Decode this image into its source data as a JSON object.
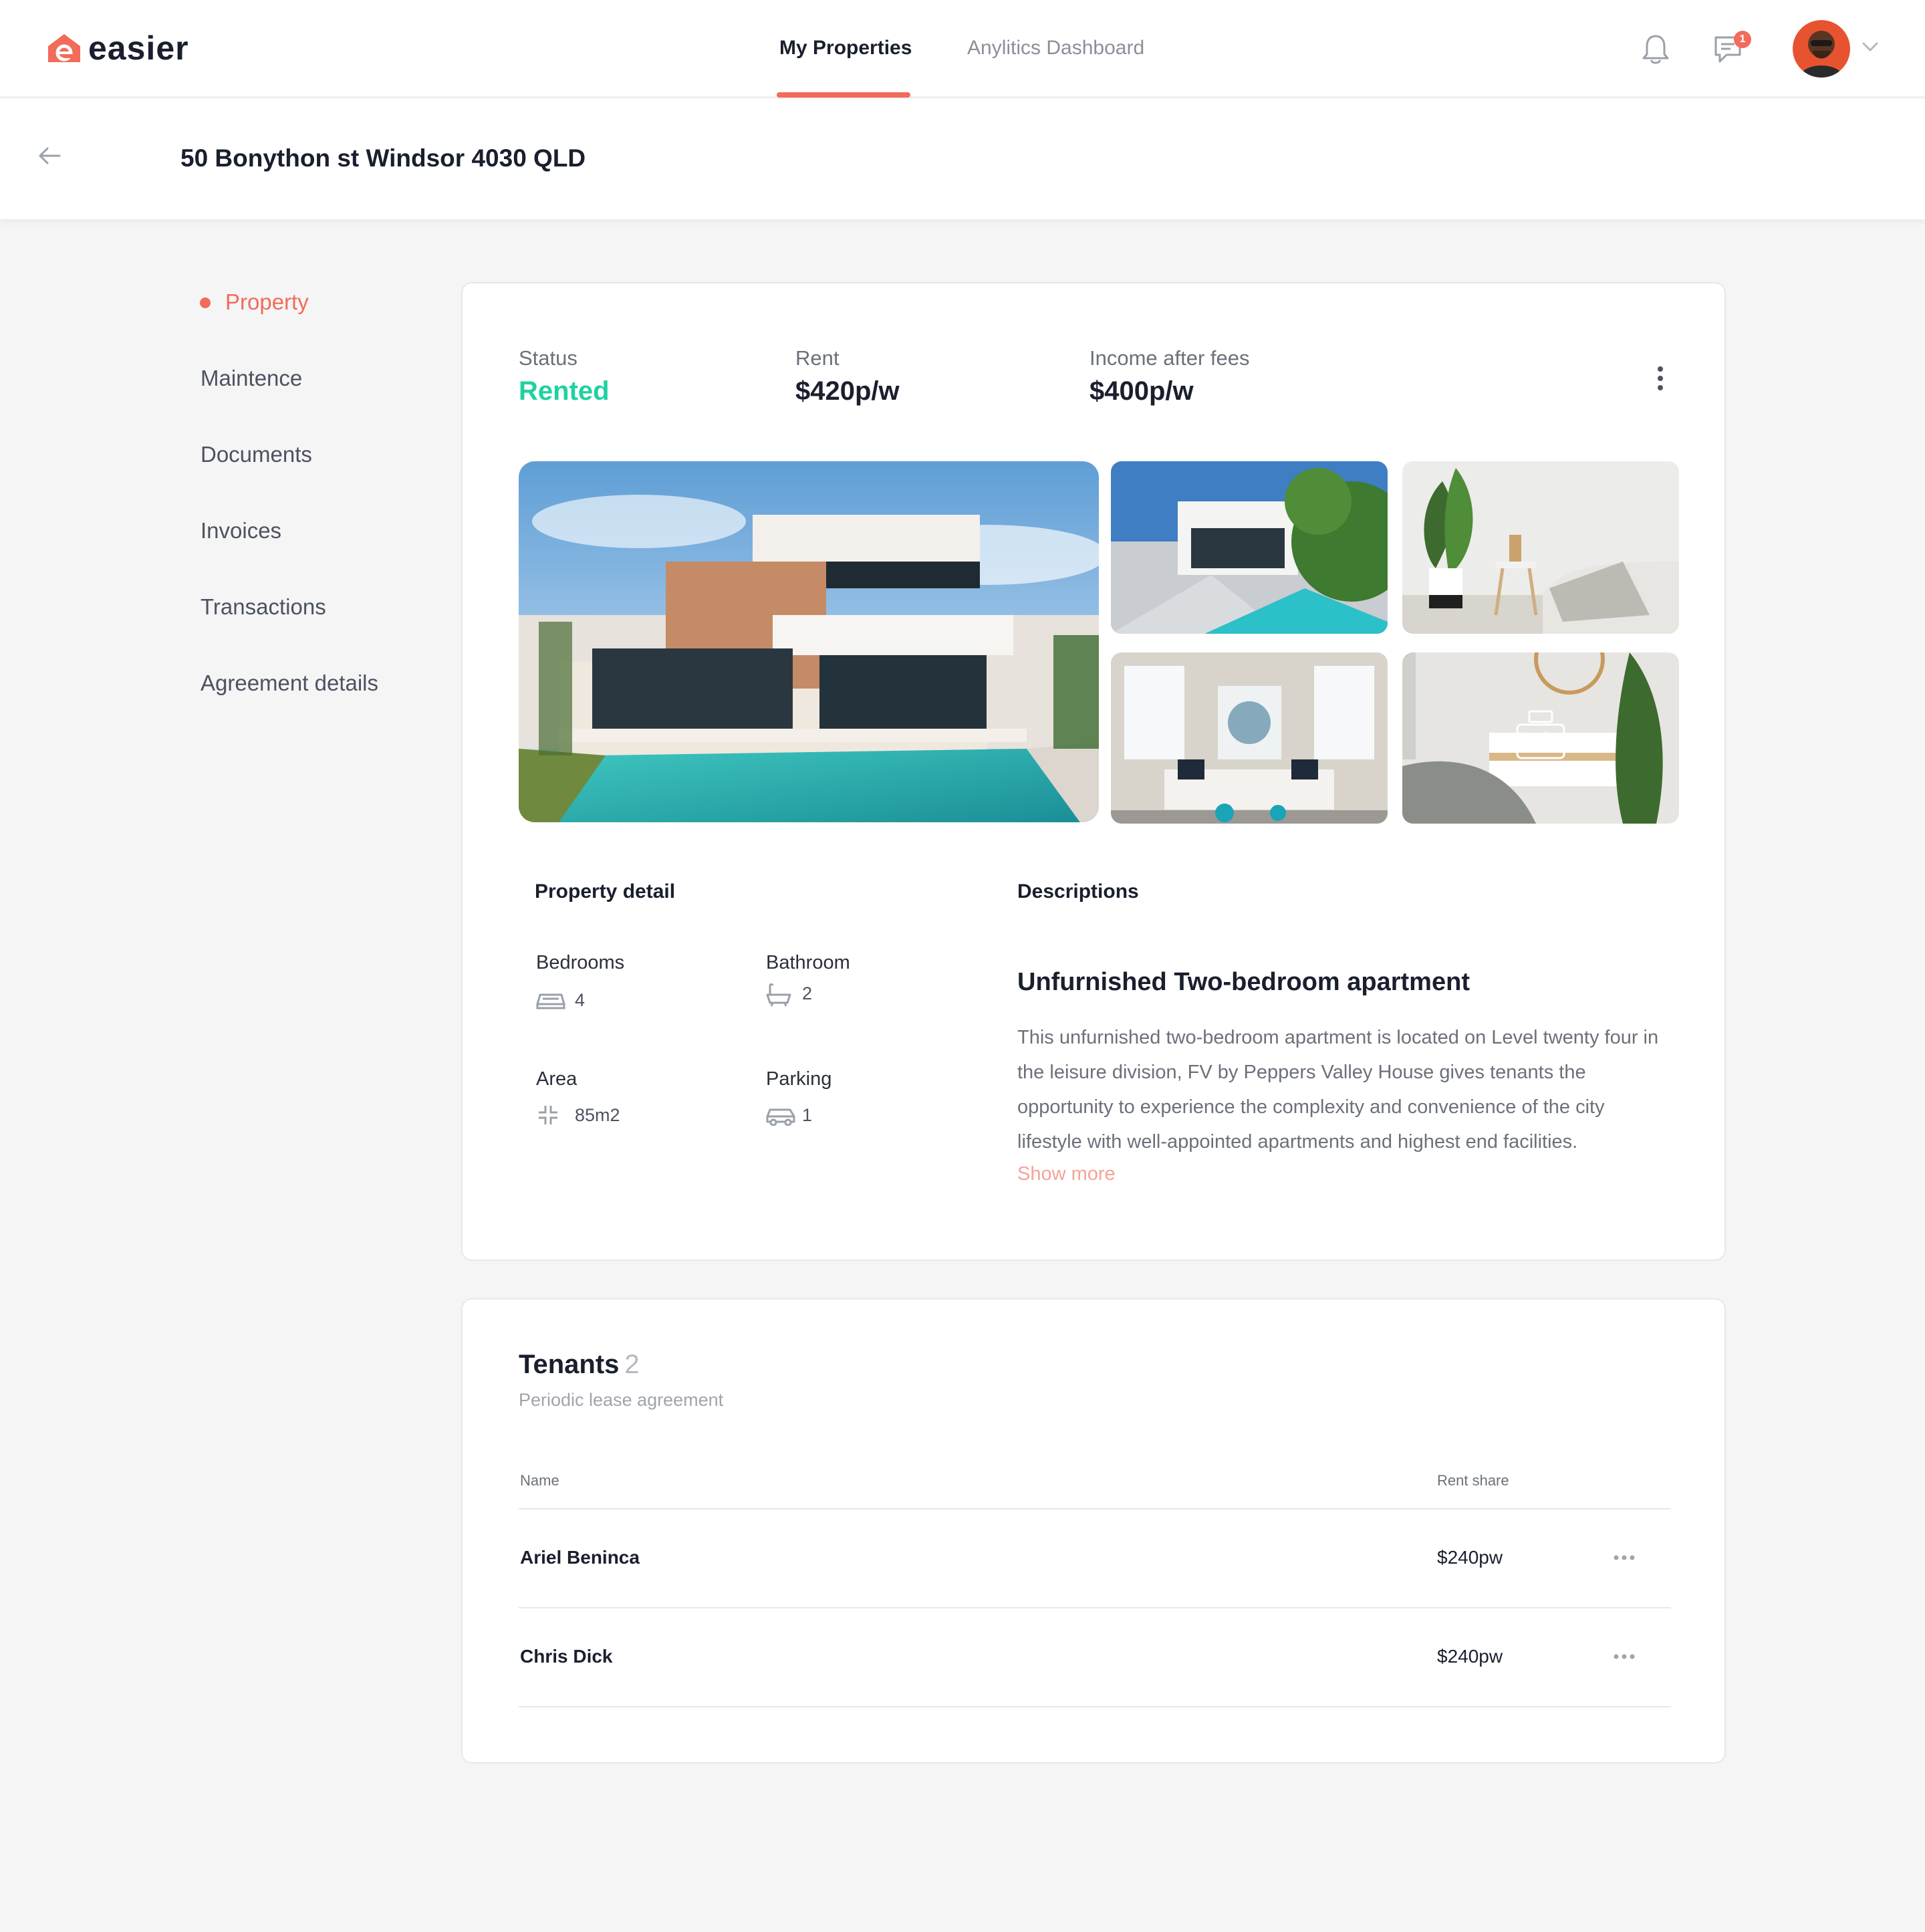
{
  "brand": {
    "name": "easier",
    "accent": "#f26b5b",
    "success": "#1fd1a2"
  },
  "nav": {
    "tabs": [
      {
        "label": "My Properties",
        "active": true
      },
      {
        "label": "Anylitics  Dashboard",
        "active": false
      }
    ],
    "icons": [
      "bell-icon",
      "chat-icon",
      "chevron-down-icon"
    ],
    "chat_badge": "1"
  },
  "header": {
    "title": "50 Bonython st  Windsor 4030 QLD"
  },
  "sidebar": {
    "items": [
      {
        "label": "Property",
        "active": true
      },
      {
        "label": "Maintence"
      },
      {
        "label": "Documents"
      },
      {
        "label": "Invoices"
      },
      {
        "label": "Transactions"
      },
      {
        "label": "Agreement details"
      }
    ]
  },
  "stats": {
    "status_label": "Status",
    "status_value": "Rented",
    "rent_label": "Rent",
    "rent_value": "$420p/w",
    "income_label": "Income after fees",
    "income_value": "$400p/w"
  },
  "details": {
    "heading": "Property detail",
    "bedrooms_label": "Bedrooms",
    "bedrooms_value": "4",
    "bathroom_label": "Bathroom",
    "bathroom_value": "2",
    "area_label": "Area",
    "area_value": "85m2",
    "parking_label": "Parking",
    "parking_value": "1"
  },
  "description": {
    "heading": "Descriptions",
    "title": "Unfurnished Two-bedroom apartment",
    "body": "This unfurnished two-bedroom apartment is located on Level twenty four in the leisure division, FV by Peppers Valley House gives tenants the opportunity to experience the complexity and convenience of the city lifestyle with well-appointed apartments and highest end facilities.",
    "show_more": "Show more"
  },
  "tenants": {
    "title": "Tenants",
    "count": "2",
    "subtitle": "Periodic lease agreement",
    "columns": {
      "name": "Name",
      "rent_share": "Rent share"
    },
    "rows": [
      {
        "name": "Ariel  Beninca",
        "rent_share": "$240pw"
      },
      {
        "name": "Chris Dick",
        "rent_share": "$240pw"
      }
    ]
  }
}
